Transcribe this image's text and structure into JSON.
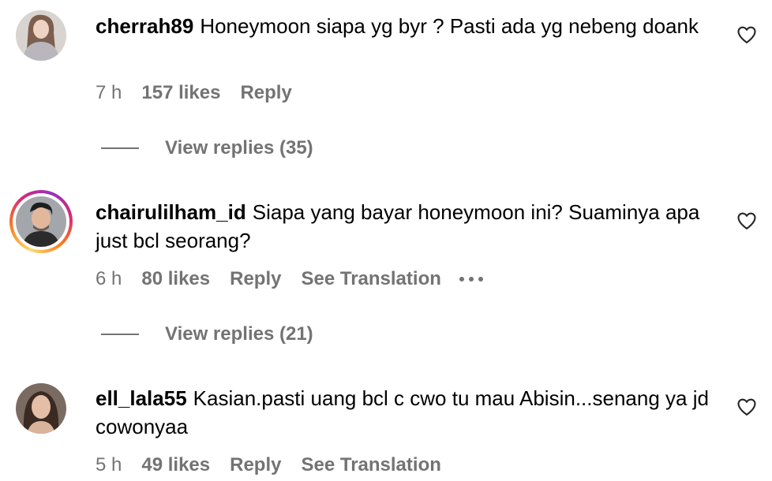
{
  "comments": [
    {
      "username": "cherrah89",
      "text": "Honeymoon siapa yg byr ? Pasti ada yg nebeng doank",
      "time": "7 h",
      "likes": "157 likes",
      "reply_label": "Reply",
      "view_replies": "View replies (35)"
    },
    {
      "username": "chairulilham_id",
      "text": "Siapa yang bayar honeymoon ini? Suaminya apa just bcl seorang?",
      "time": "6 h",
      "likes": "80 likes",
      "reply_label": "Reply",
      "translation_label": "See Translation",
      "view_replies": "View replies (21)"
    },
    {
      "username": "ell_lala55",
      "text": "Kasian.pasti uang bcl c cwo tu mau Abisin...senang ya jd cowonyaa",
      "time": "5 h",
      "likes": "49 likes",
      "reply_label": "Reply",
      "translation_label": "See Translation"
    }
  ],
  "icons": {
    "like": "heart-outline-icon",
    "more": "more-options-icon"
  },
  "colors": {
    "secondary_text": "#737373",
    "story_ring": [
      "#feda75",
      "#fa7e1e",
      "#d62976",
      "#962fbf"
    ]
  }
}
